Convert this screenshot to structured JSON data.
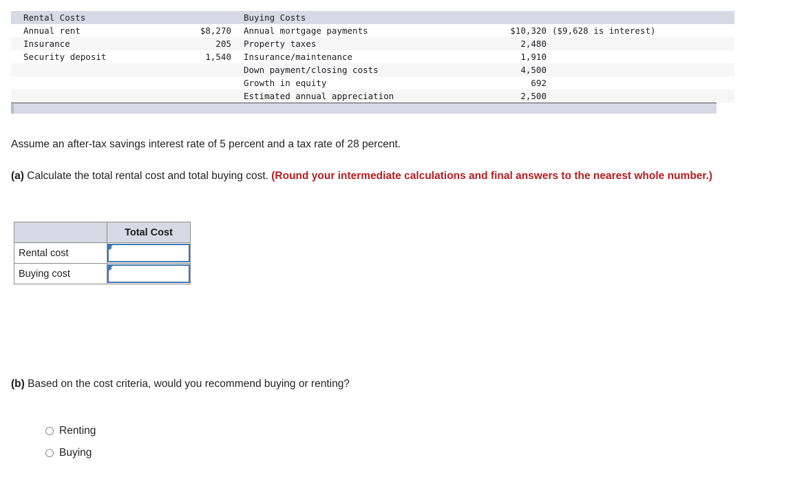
{
  "exhibit": {
    "header": {
      "rental_title": "Rental Costs",
      "buying_title": "Buying Costs"
    },
    "rows": [
      {
        "rental_label": "Annual rent",
        "rental_value": "$8,270",
        "buying_label": "Annual mortgage payments",
        "buying_value": "$10,320",
        "buying_note": "($9,628 is interest)"
      },
      {
        "rental_label": "Insurance",
        "rental_value": "205",
        "buying_label": "Property taxes",
        "buying_value": "2,480",
        "buying_note": ""
      },
      {
        "rental_label": "Security deposit",
        "rental_value": "1,540",
        "buying_label": "Insurance/maintenance",
        "buying_value": "1,910",
        "buying_note": ""
      },
      {
        "rental_label": "",
        "rental_value": "",
        "buying_label": "Down payment/closing costs",
        "buying_value": "4,500",
        "buying_note": ""
      },
      {
        "rental_label": "",
        "rental_value": "",
        "buying_label": "Growth in equity",
        "buying_value": "692",
        "buying_note": ""
      },
      {
        "rental_label": "",
        "rental_value": "",
        "buying_label": "Estimated annual appreciation",
        "buying_value": "2,500",
        "buying_note": ""
      }
    ]
  },
  "prose": {
    "assumption": "Assume an after-tax savings interest rate of 5 percent and a tax rate of 28 percent.",
    "question_a_marker": "(a)",
    "question_a_text": "Calculate the total rental cost and total buying cost.",
    "question_a_round_note": "(Round your intermediate calculations and final answers to the nearest whole number.)",
    "question_b_marker": "(b)",
    "question_b_text": "Based on the cost criteria, would you recommend buying or renting?"
  },
  "answer_table": {
    "header_blank": "",
    "header_total_cost": "Total Cost",
    "rows": [
      {
        "label": "Rental cost",
        "value": "",
        "placeholder": ""
      },
      {
        "label": "Buying cost",
        "value": "",
        "placeholder": ""
      }
    ]
  },
  "choices": {
    "options": [
      {
        "label": "Renting",
        "selected": false
      },
      {
        "label": "Buying",
        "selected": false
      }
    ]
  },
  "colors": {
    "header_band": "#d7dae4",
    "stripe": "#f6f6f7",
    "input_border": "#4278b5",
    "round_note_red": "#b61d22",
    "table_border": "#8b8b8b"
  }
}
